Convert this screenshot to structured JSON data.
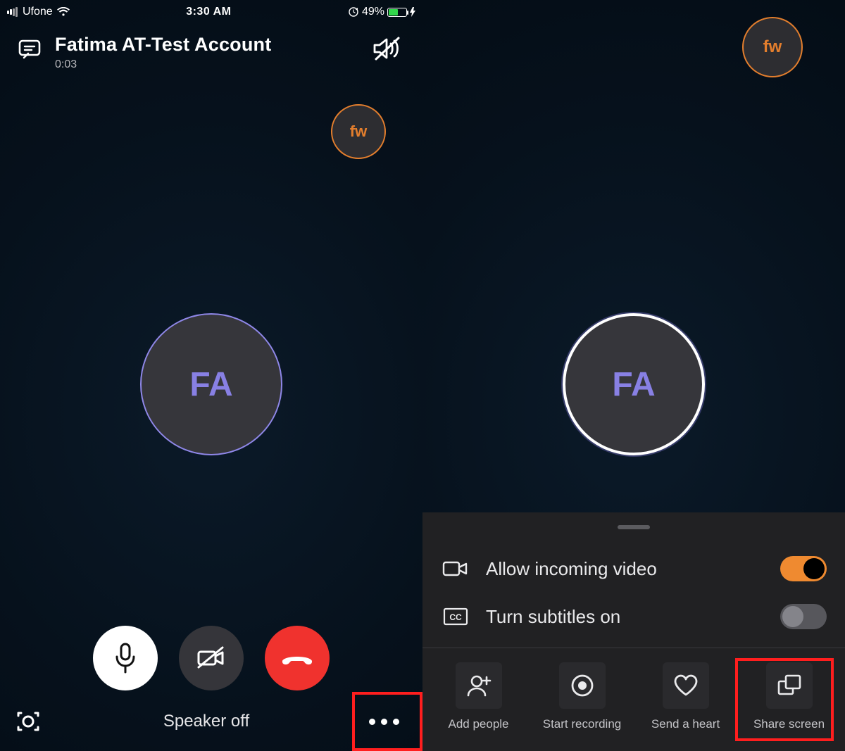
{
  "status_bar": {
    "carrier": "Ufone",
    "time": "3:30 AM",
    "battery_pct": "49%"
  },
  "header": {
    "contact_name": "Fatima AT-Test Account",
    "duration": "0:03"
  },
  "self_avatar_initials": "fw",
  "main_avatar_initials": "FA",
  "toast": {
    "speaker_off": "Speaker off"
  },
  "sheet": {
    "allow_video_label": "Allow incoming video",
    "subtitles_label": "Turn subtitles on",
    "actions": {
      "add_people": "Add people",
      "start_recording": "Start recording",
      "send_heart": "Send a heart",
      "share_screen": "Share screen"
    }
  }
}
